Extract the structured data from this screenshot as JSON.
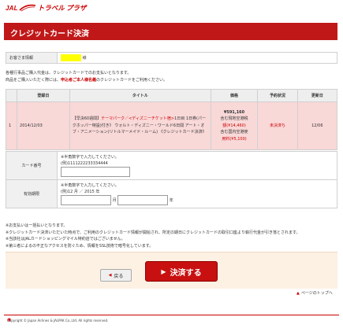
{
  "header": {
    "logo_jal": "JAL",
    "logo_brand": "トラベル プラザ"
  },
  "page": {
    "title": "クレジットカード決済"
  },
  "customer": {
    "label": "お客さま情報",
    "suffix": "様"
  },
  "instructions": {
    "line1": "各種行事品ご購入代金は、クレジットカードでのお支払いとなります。",
    "line2_a": "商品をご購入いただく際には、",
    "line2_b": "申込者ご本人様名義",
    "line2_c": "のクレジットカードをご利用ください。"
  },
  "order_table": {
    "headers": [
      "",
      "登録日",
      "タイトル",
      "価格",
      "予約状況",
      "更新日"
    ],
    "row": {
      "index": "1",
      "date": "2014/12/03",
      "title_a": "【早決60週間】",
      "title_b": "テーマパーク／<ディズニーチケット宿>",
      "title_c": "1日目 1日券(パークホッパー特設)付き》 ウォルト・ディズニー・ワールド6日間 アート・オブ・アニメーション(リトルマーメイド・ルーム) 《クレジットカード決済》",
      "price_total": "¥591,160",
      "price_line1": "含む現地空港税",
      "price_line2": "額(¥14,460)",
      "price_line3": "含む国内空港使",
      "price_line4": "用料(¥5,100)",
      "status": "未決済ち",
      "updated": "12/06"
    }
  },
  "card_form": {
    "number_label": "カード番号",
    "number_hint": "※半角数字で入力してください。",
    "number_example": "(例)1111222233334444",
    "number_value": "",
    "expiry_label": "有効期限",
    "expiry_hint": "※半角数字で入力してください。",
    "expiry_example": "(例)12 月 ／ 2015 年",
    "month_unit": "月",
    "year_unit": "年",
    "month_value": "",
    "year_value": ""
  },
  "notes": [
    "※お支払いは一括払いとなります。",
    "※クレジットカード決済いただいた時点で、ご利用のクレジットカード情報が開始され、所定の期日にクレジットカードの取引口座より執行代金が引き落とされます。",
    "※当該社はJALカードショッピングマイル特約店ではございません。",
    "※第三者によるの不正なアクセスを防ぐため、情報をSSL技術で暗号化しています。"
  ],
  "buttons": {
    "back": "戻る",
    "pay": "決済する"
  },
  "links": {
    "to_top": "ページのトップへ"
  },
  "footer": {
    "copyright": "Copyright © Japan Airlines & JALPAK Co.,Ltd. All rights reserved."
  },
  "colors": {
    "brand_red": "#c01818",
    "highlight_row": "#f9d8d8",
    "button_area": "#fdf1e3"
  }
}
